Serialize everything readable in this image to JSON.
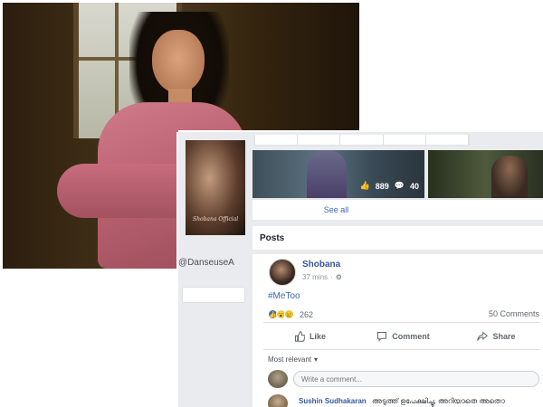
{
  "profile": {
    "username_fragment": "DanseuseA",
    "signature_text": "Shobana Official"
  },
  "media": {
    "likes": "889",
    "comments": "40",
    "see_all": "See all"
  },
  "posts": {
    "section_title": "Posts",
    "author": "Shobana",
    "time": "37 mins",
    "text": "#MeToo",
    "reaction_count": "262",
    "comment_count": "50 Comments",
    "actions": {
      "like": "Like",
      "comment": "Comment",
      "share": "Share"
    },
    "sort_label": "Most relevant",
    "comment_placeholder": "Write a comment...",
    "first_comment": {
      "name": "Sushin Sudhakaran",
      "text": "അടുത്ത് ഉപേക്ഷിച്ചു, അറിയാതെ അതൊ"
    }
  },
  "colors": {
    "fb_blue": "#4267b2",
    "link_blue": "#365899",
    "bg_gray": "#e9ebee"
  }
}
